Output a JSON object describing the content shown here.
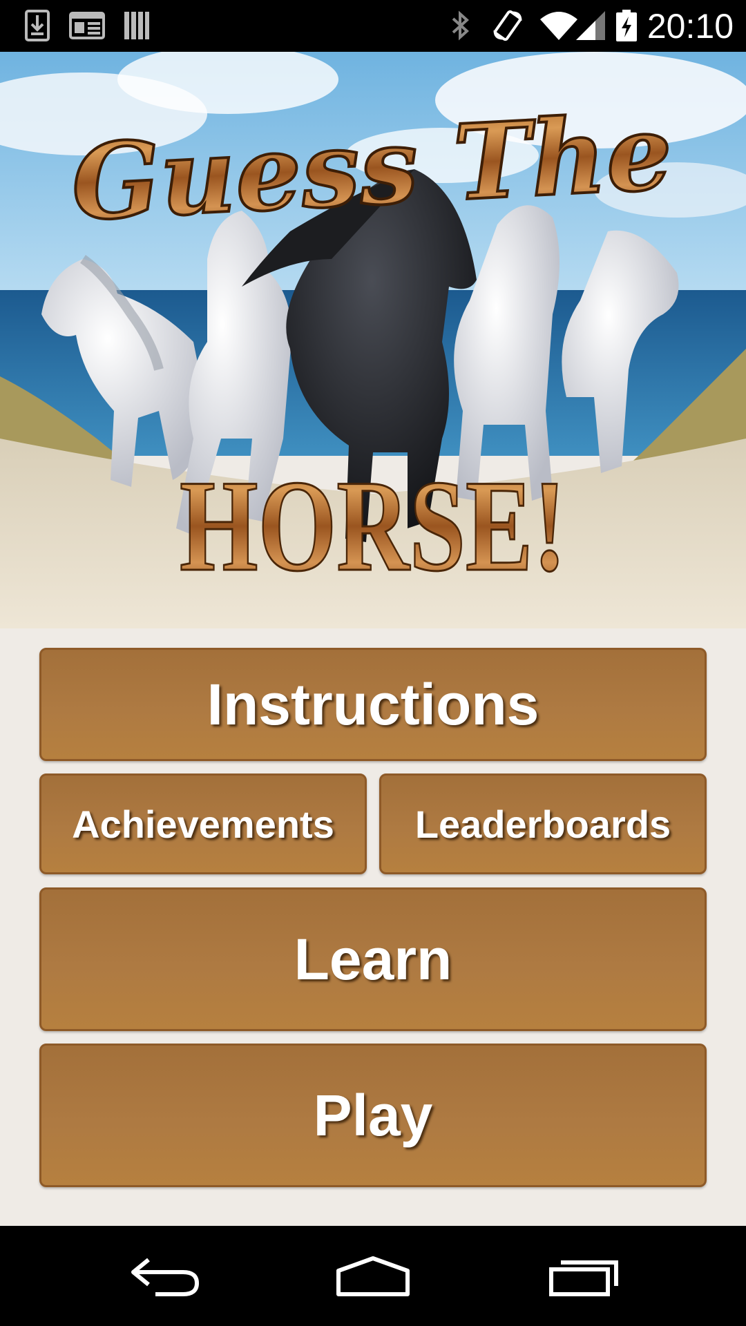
{
  "status_bar": {
    "time": "20:10",
    "left_icons": [
      "download-icon",
      "news-icon",
      "library-icon"
    ],
    "right_icons": [
      "bluetooth-icon",
      "rotation-icon",
      "wifi-icon",
      "cell-signal-icon",
      "battery-charging-icon"
    ]
  },
  "banner": {
    "title_line1": "Guess The",
    "title_line2": "HORSE!"
  },
  "menu": {
    "instructions": "Instructions",
    "achievements": "Achievements",
    "leaderboards": "Leaderboards",
    "learn": "Learn",
    "play": "Play",
    "button_color": "#ac7840"
  },
  "nav_bar": {
    "icons": [
      "back-icon",
      "home-icon",
      "recents-icon"
    ]
  }
}
